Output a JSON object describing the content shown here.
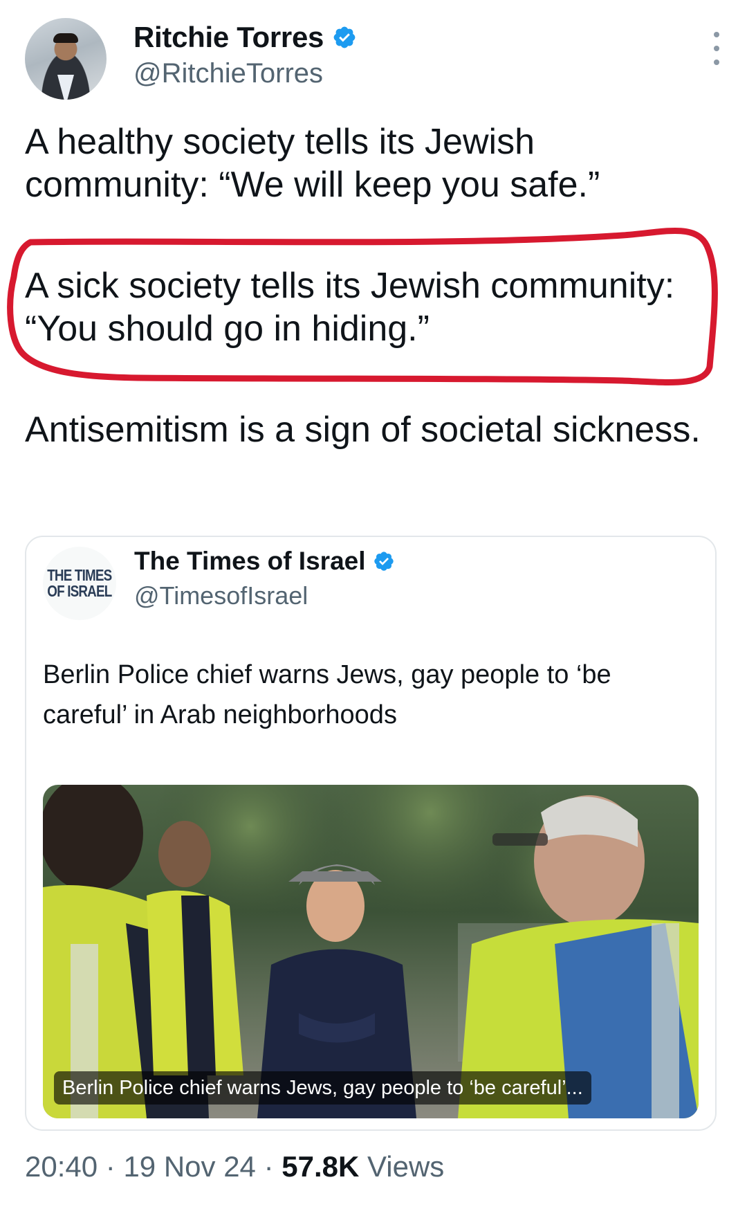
{
  "tweet": {
    "author": {
      "display_name": "Ritchie Torres",
      "handle": "@RitchieTorres",
      "verified": true
    },
    "paragraphs": [
      "A healthy society tells its Jewish community: “We will keep you safe.”",
      "A sick society tells its Jewish community: “You should go in hiding.”",
      "Antisemitism is a sign of societal sickness."
    ],
    "highlighted_paragraph_color": "#d7192f",
    "quoted": {
      "logo_text_line1": "THE TIMES",
      "logo_text_line2": "OF ISRAEL",
      "display_name": "The Times of Israel",
      "handle": "@TimesofIsrael",
      "verified": true,
      "text": "Berlin Police chief warns Jews, gay people to ‘be careful’ in Arab neighborhoods",
      "card_caption": "Berlin Police chief warns Jews, gay people to ‘be careful’..."
    },
    "time": "20:40",
    "separator": "·",
    "date": "19 Nov 24",
    "views_count": "57.8K",
    "views_label": "Views"
  },
  "colors": {
    "verified_badge": "#1d9bf0",
    "secondary_text": "#536471",
    "primary_text": "#0f1419"
  },
  "icons": {
    "verified": "verified-badge-icon",
    "more": "more-vertical-icon"
  }
}
